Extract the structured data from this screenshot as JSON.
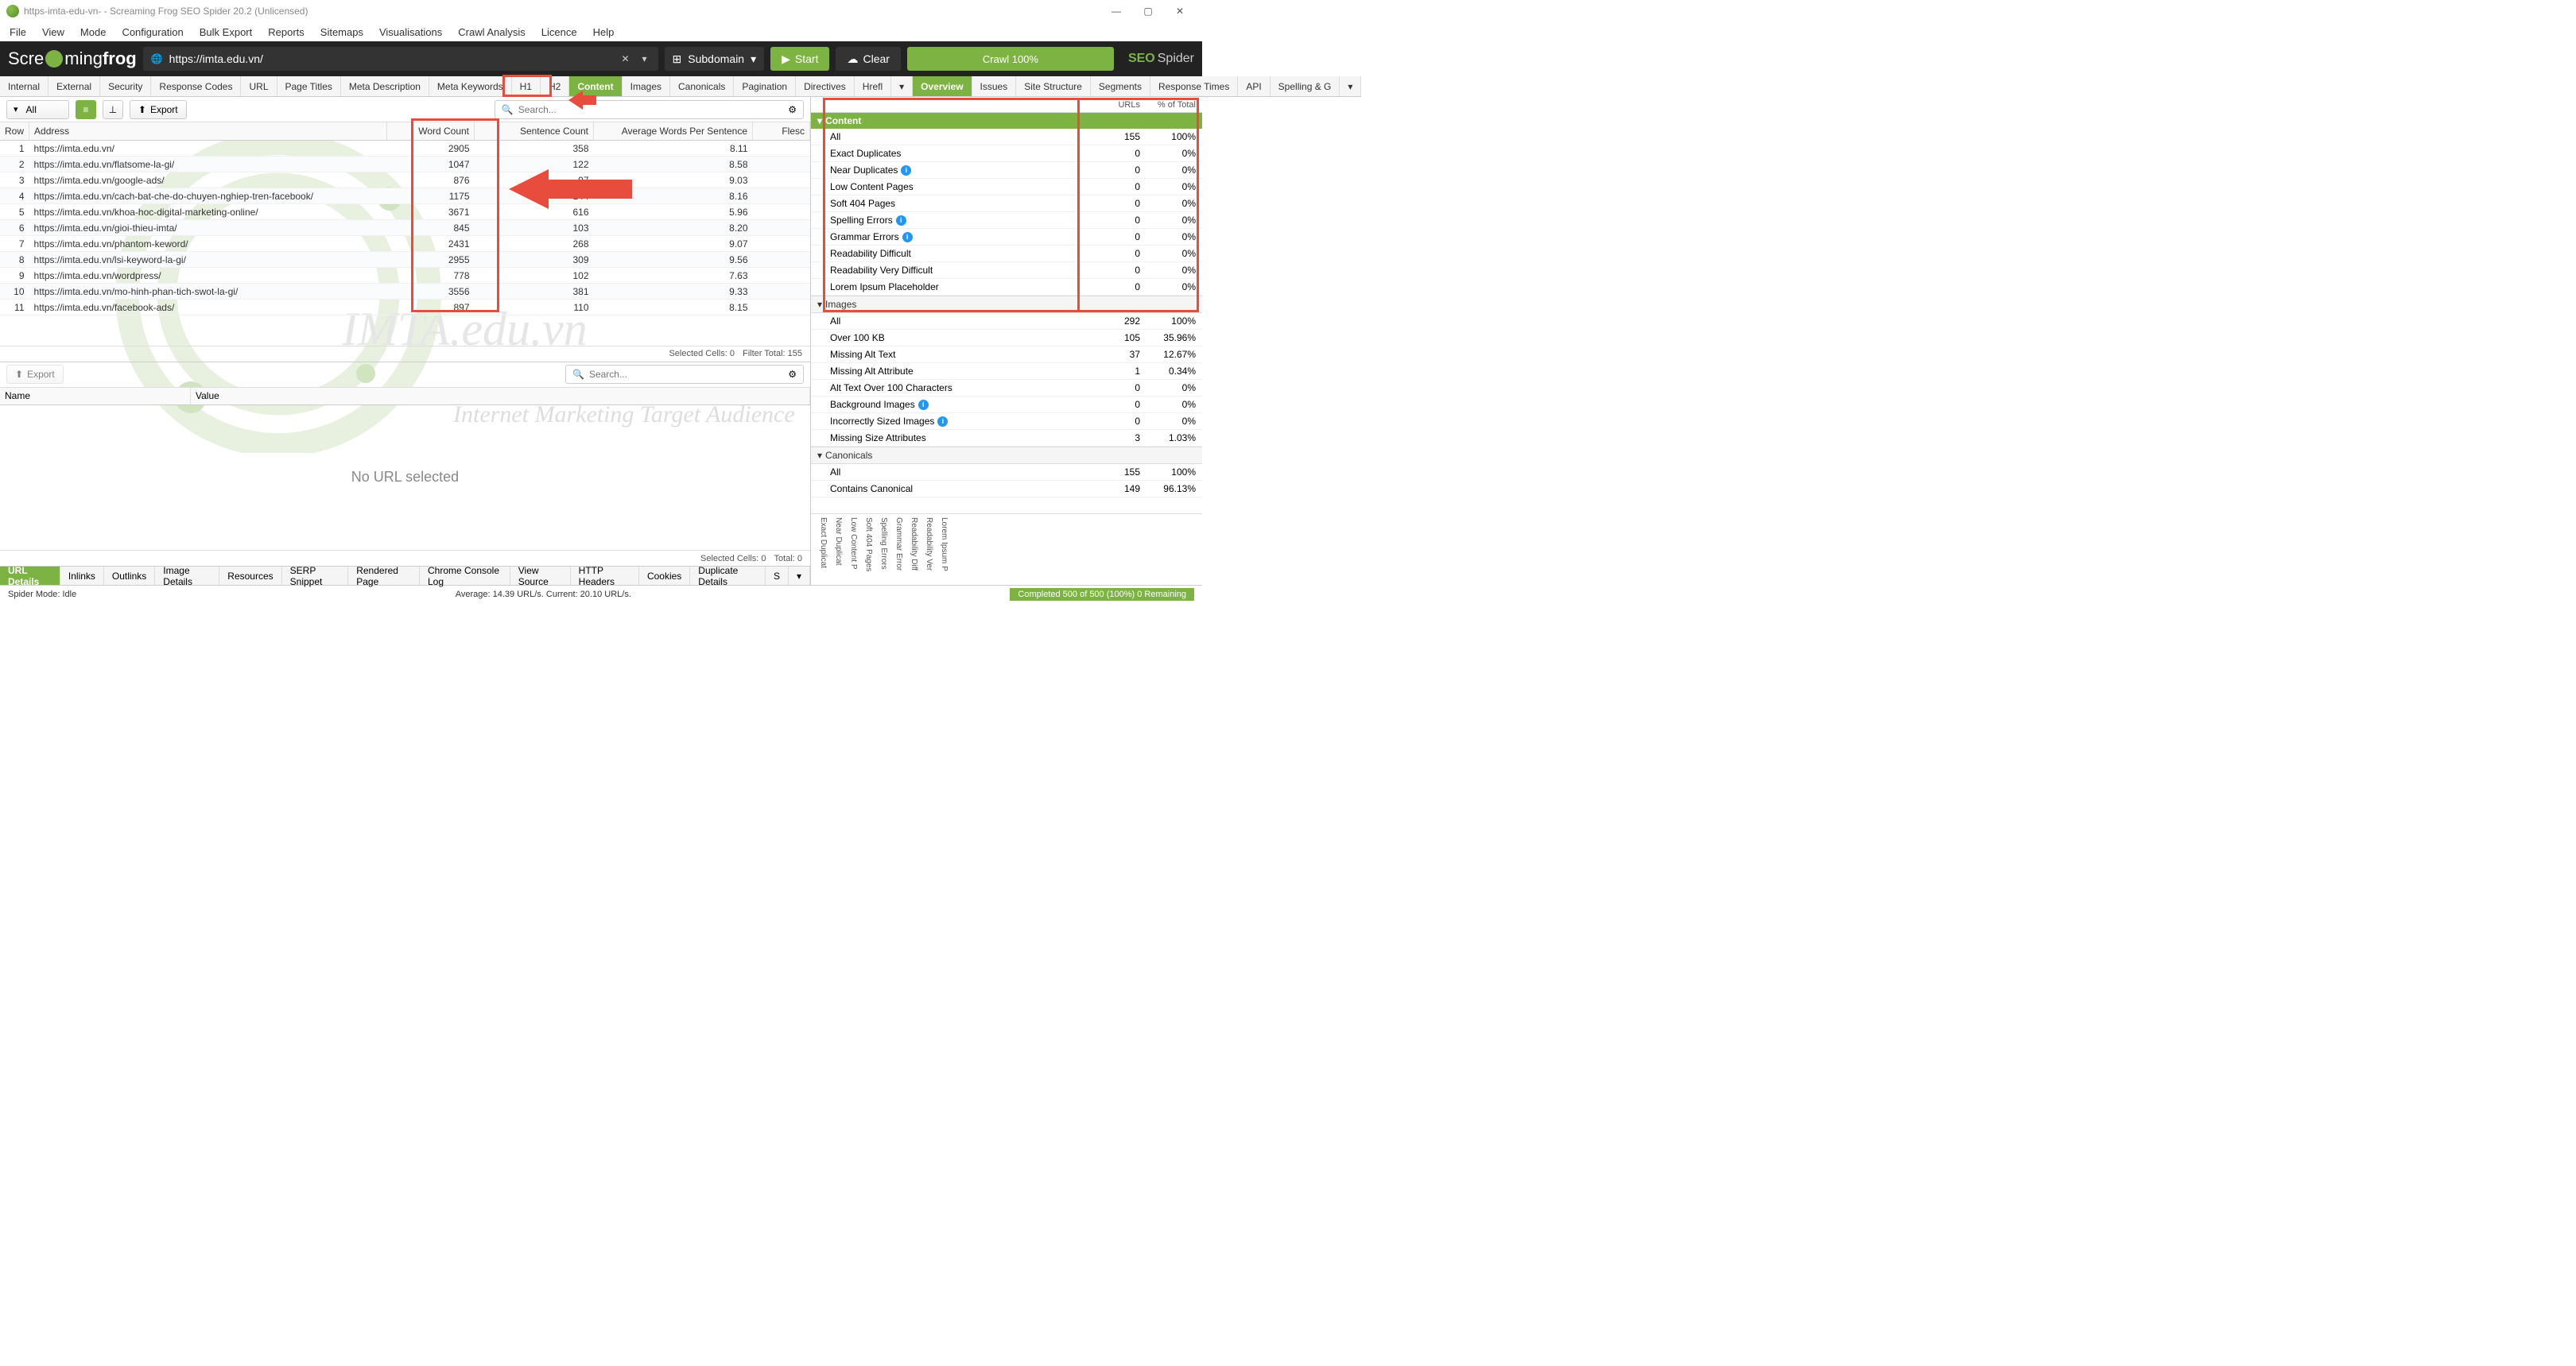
{
  "title": "https-imta-edu-vn- - Screaming Frog SEO Spider 20.2 (Unlicensed)",
  "menu": [
    "File",
    "View",
    "Mode",
    "Configuration",
    "Bulk Export",
    "Reports",
    "Sitemaps",
    "Visualisations",
    "Crawl Analysis",
    "Licence",
    "Help"
  ],
  "url": "https://imta.edu.vn/",
  "scope_label": "Subdomain",
  "btn_start": "Start",
  "btn_clear": "Clear",
  "progress": "Crawl 100%",
  "brand1": "SEO",
  "brand2": "Spider",
  "main_tabs": [
    "Internal",
    "External",
    "Security",
    "Response Codes",
    "URL",
    "Page Titles",
    "Meta Description",
    "Meta Keywords",
    "H1",
    "H2",
    "Content",
    "Images",
    "Canonicals",
    "Pagination",
    "Directives",
    "Hrefl"
  ],
  "active_main_tab": "Content",
  "right_tabs": [
    "Overview",
    "Issues",
    "Site Structure",
    "Segments",
    "Response Times",
    "API",
    "Spelling & G"
  ],
  "active_right_tab": "Overview",
  "right_headers": {
    "c1": "URLs",
    "c2": "% of Total"
  },
  "filter_all": "All",
  "btn_export": "Export",
  "search_ph": "Search...",
  "cols": {
    "row": "Row",
    "addr": "Address",
    "wc": "Word Count",
    "sc": "Sentence Count",
    "awps": "Average Words Per Sentence",
    "flesch": "Flesc"
  },
  "rows": [
    {
      "n": 1,
      "a": "https://imta.edu.vn/",
      "wc": 2905,
      "sc": 358,
      "awps": "8.11"
    },
    {
      "n": 2,
      "a": "https://imta.edu.vn/flatsome-la-gi/",
      "wc": 1047,
      "sc": 122,
      "awps": "8.58"
    },
    {
      "n": 3,
      "a": "https://imta.edu.vn/google-ads/",
      "wc": 876,
      "sc": 97,
      "awps": "9.03"
    },
    {
      "n": 4,
      "a": "https://imta.edu.vn/cach-bat-che-do-chuyen-nghiep-tren-facebook/",
      "wc": 1175,
      "sc": 144,
      "awps": "8.16"
    },
    {
      "n": 5,
      "a": "https://imta.edu.vn/khoa-hoc-digital-marketing-online/",
      "wc": 3671,
      "sc": 616,
      "awps": "5.96"
    },
    {
      "n": 6,
      "a": "https://imta.edu.vn/gioi-thieu-imta/",
      "wc": 845,
      "sc": 103,
      "awps": "8.20"
    },
    {
      "n": 7,
      "a": "https://imta.edu.vn/phantom-keword/",
      "wc": 2431,
      "sc": 268,
      "awps": "9.07"
    },
    {
      "n": 8,
      "a": "https://imta.edu.vn/lsi-keyword-la-gi/",
      "wc": 2955,
      "sc": 309,
      "awps": "9.56"
    },
    {
      "n": 9,
      "a": "https://imta.edu.vn/wordpress/",
      "wc": 778,
      "sc": 102,
      "awps": "7.63"
    },
    {
      "n": 10,
      "a": "https://imta.edu.vn/mo-hinh-phan-tich-swot-la-gi/",
      "wc": 3556,
      "sc": 381,
      "awps": "9.33"
    },
    {
      "n": 11,
      "a": "https://imta.edu.vn/facebook-ads/",
      "wc": 897,
      "sc": 110,
      "awps": "8.15"
    }
  ],
  "status_top": {
    "sel": "Selected Cells: 0",
    "ft": "Filter Total: 155"
  },
  "lower_cols": {
    "name": "Name",
    "value": "Value"
  },
  "no_url": "No URL selected",
  "status_low": {
    "sel": "Selected Cells: 0",
    "tot": "Total: 0"
  },
  "lower_tabs": [
    "URL Details",
    "Inlinks",
    "Outlinks",
    "Image Details",
    "Resources",
    "SERP Snippet",
    "Rendered Page",
    "Chrome Console Log",
    "View Source",
    "HTTP Headers",
    "Cookies",
    "Duplicate Details",
    "S"
  ],
  "active_lower_tab": "URL Details",
  "status_mode": "Spider Mode: Idle",
  "status_avg": "Average: 14.39 URL/s. Current: 20.10 URL/s.",
  "status_done": "Completed 500 of 500 (100%) 0 Remaining",
  "ov": {
    "content": {
      "hdr": "Content",
      "rows": [
        {
          "l": "All",
          "v": 155,
          "p": "100%"
        },
        {
          "l": "Exact Duplicates",
          "v": 0,
          "p": "0%"
        },
        {
          "l": "Near Duplicates",
          "i": true,
          "v": 0,
          "p": "0%"
        },
        {
          "l": "Low Content Pages",
          "v": 0,
          "p": "0%"
        },
        {
          "l": "Soft 404 Pages",
          "v": 0,
          "p": "0%"
        },
        {
          "l": "Spelling Errors",
          "i": true,
          "v": 0,
          "p": "0%"
        },
        {
          "l": "Grammar Errors",
          "i": true,
          "v": 0,
          "p": "0%"
        },
        {
          "l": "Readability Difficult",
          "v": 0,
          "p": "0%"
        },
        {
          "l": "Readability Very Difficult",
          "v": 0,
          "p": "0%"
        },
        {
          "l": "Lorem Ipsum Placeholder",
          "v": 0,
          "p": "0%"
        }
      ]
    },
    "images": {
      "hdr": "Images",
      "rows": [
        {
          "l": "All",
          "v": 292,
          "p": "100%"
        },
        {
          "l": "Over 100 KB",
          "v": 105,
          "p": "35.96%"
        },
        {
          "l": "Missing Alt Text",
          "v": 37,
          "p": "12.67%"
        },
        {
          "l": "Missing Alt Attribute",
          "v": 1,
          "p": "0.34%"
        },
        {
          "l": "Alt Text Over 100 Characters",
          "v": 0,
          "p": "0%"
        },
        {
          "l": "Background Images",
          "i": true,
          "v": 0,
          "p": "0%"
        },
        {
          "l": "Incorrectly Sized Images",
          "i": true,
          "v": 0,
          "p": "0%"
        },
        {
          "l": "Missing Size Attributes",
          "v": 3,
          "p": "1.03%"
        }
      ]
    },
    "canonicals": {
      "hdr": "Canonicals",
      "rows": [
        {
          "l": "All",
          "v": 155,
          "p": "100%"
        },
        {
          "l": "Contains Canonical",
          "v": 149,
          "p": "96.13%"
        }
      ]
    }
  },
  "vlabels": [
    "Exact Duplicat",
    "Near Duplicat",
    "Low Content P",
    "Soft 404 Pages",
    "Spelling Errors",
    "Grammar Error",
    "Readability Diff",
    "Readability Ver",
    "Lorem Ipsum P"
  ],
  "wm1": "IMTA.edu.vn",
  "wm2": "Internet Marketing Target Audience"
}
